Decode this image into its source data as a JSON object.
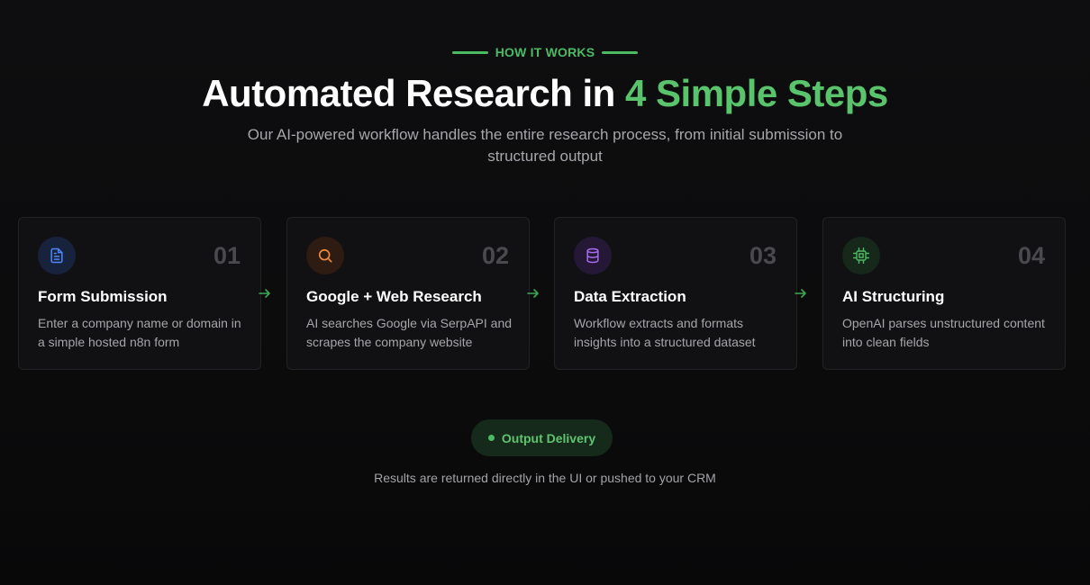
{
  "section": {
    "eyebrow": "HOW IT WORKS",
    "headline_main": "Automated Research in ",
    "headline_accent": "4 Simple Steps",
    "subtitle": "Our AI-powered workflow handles the entire research process, from initial submission to structured output"
  },
  "steps": [
    {
      "number": "01",
      "title": "Form Submission",
      "description": "Enter a company name or domain in a simple hosted n8n form",
      "icon": "document-icon",
      "icon_color": "#4f86f7",
      "icon_bg": "#17233d"
    },
    {
      "number": "02",
      "title": "Google + Web Research",
      "description": "AI searches Google via SerpAPI and scrapes the company website",
      "icon": "search-icon",
      "icon_color": "#f08a3c",
      "icon_bg": "#2e1c12"
    },
    {
      "number": "03",
      "title": "Data Extraction",
      "description": "Workflow extracts and formats insights into a structured dataset",
      "icon": "database-icon",
      "icon_color": "#a66cf0",
      "icon_bg": "#241836"
    },
    {
      "number": "04",
      "title": "AI Structuring",
      "description": "OpenAI parses unstructured content into clean fields",
      "icon": "cpu-icon",
      "icon_color": "#4cba63",
      "icon_bg": "#15281a"
    }
  ],
  "output": {
    "label": "Output Delivery",
    "note": "Results are returned directly in the UI or pushed to your CRM"
  },
  "colors": {
    "accent": "#59c46c",
    "background": "#0b0b0c",
    "card": "#111113"
  }
}
